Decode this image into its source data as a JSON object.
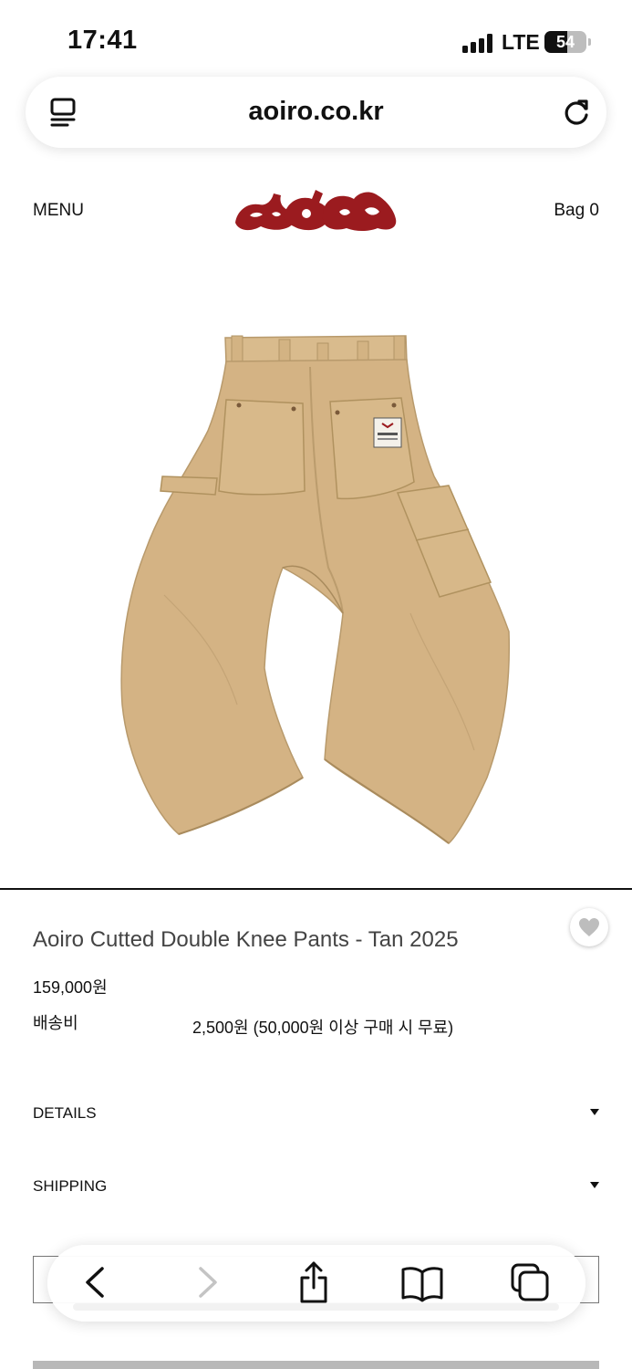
{
  "status_bar": {
    "time": "17:41",
    "network": "LTE",
    "battery_level": "54",
    "battery_fraction": 0.54
  },
  "browser": {
    "url": "aoiro.co.kr",
    "reader_icon": "reader-mode-icon",
    "reload_icon": "reload-icon"
  },
  "header": {
    "menu_label": "MENU",
    "bag_label": "Bag 0",
    "logo_color": "#9b1b1f"
  },
  "product": {
    "image_icon": "tan-pants-photo",
    "title": "Aoiro Cutted Double Knee Pants - Tan 2025",
    "price": "159,000원",
    "shipping_label": "배송비",
    "shipping_value": "2,500원 (50,000원 이상 구매 시 무료)",
    "wishlist_icon": "heart-icon"
  },
  "accordions": [
    {
      "label": "DETAILS"
    },
    {
      "label": "SHIPPING"
    }
  ],
  "toolbar": {
    "back_icon": "chevron-left-icon",
    "forward_icon": "chevron-right-icon",
    "share_icon": "share-icon",
    "bookmarks_icon": "book-icon",
    "tabs_icon": "tabs-icon"
  },
  "colors": {
    "pants": "#d4b384",
    "logo": "#9b1b1f",
    "text": "#111111"
  }
}
